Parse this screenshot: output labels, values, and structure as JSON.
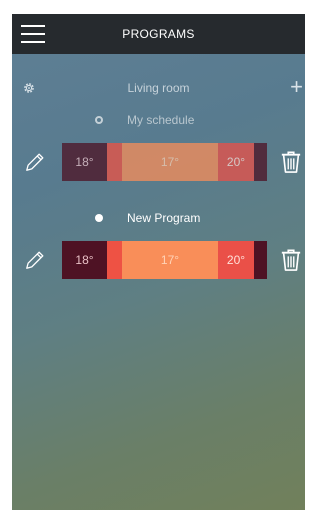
{
  "header": {
    "title": "PROGRAMS",
    "menu_icon": "hamburger-icon"
  },
  "room": {
    "name": "Living room",
    "settings_icon": "gear-icon",
    "add_icon": "plus-icon"
  },
  "programs": [
    {
      "name": "My schedule",
      "selected": false,
      "segments": [
        {
          "label": "18°",
          "color": "#4e1224"
        },
        {
          "label": "",
          "color": "#ee5244"
        },
        {
          "label": "17°",
          "color": "#f98e59"
        },
        {
          "label": "20°",
          "color": "#ea5048"
        },
        {
          "label": "",
          "color": "#4e1224"
        }
      ]
    },
    {
      "name": "New Program",
      "selected": true,
      "segments": [
        {
          "label": "18°",
          "color": "#4e1224"
        },
        {
          "label": "",
          "color": "#ee5244"
        },
        {
          "label": "17°",
          "color": "#f98e59"
        },
        {
          "label": "20°",
          "color": "#ea5048"
        },
        {
          "label": "",
          "color": "#4e1224"
        }
      ]
    }
  ],
  "icons": {
    "edit": "pencil-icon",
    "delete": "trash-icon"
  },
  "colors": {
    "topbar": "#262a2e"
  }
}
